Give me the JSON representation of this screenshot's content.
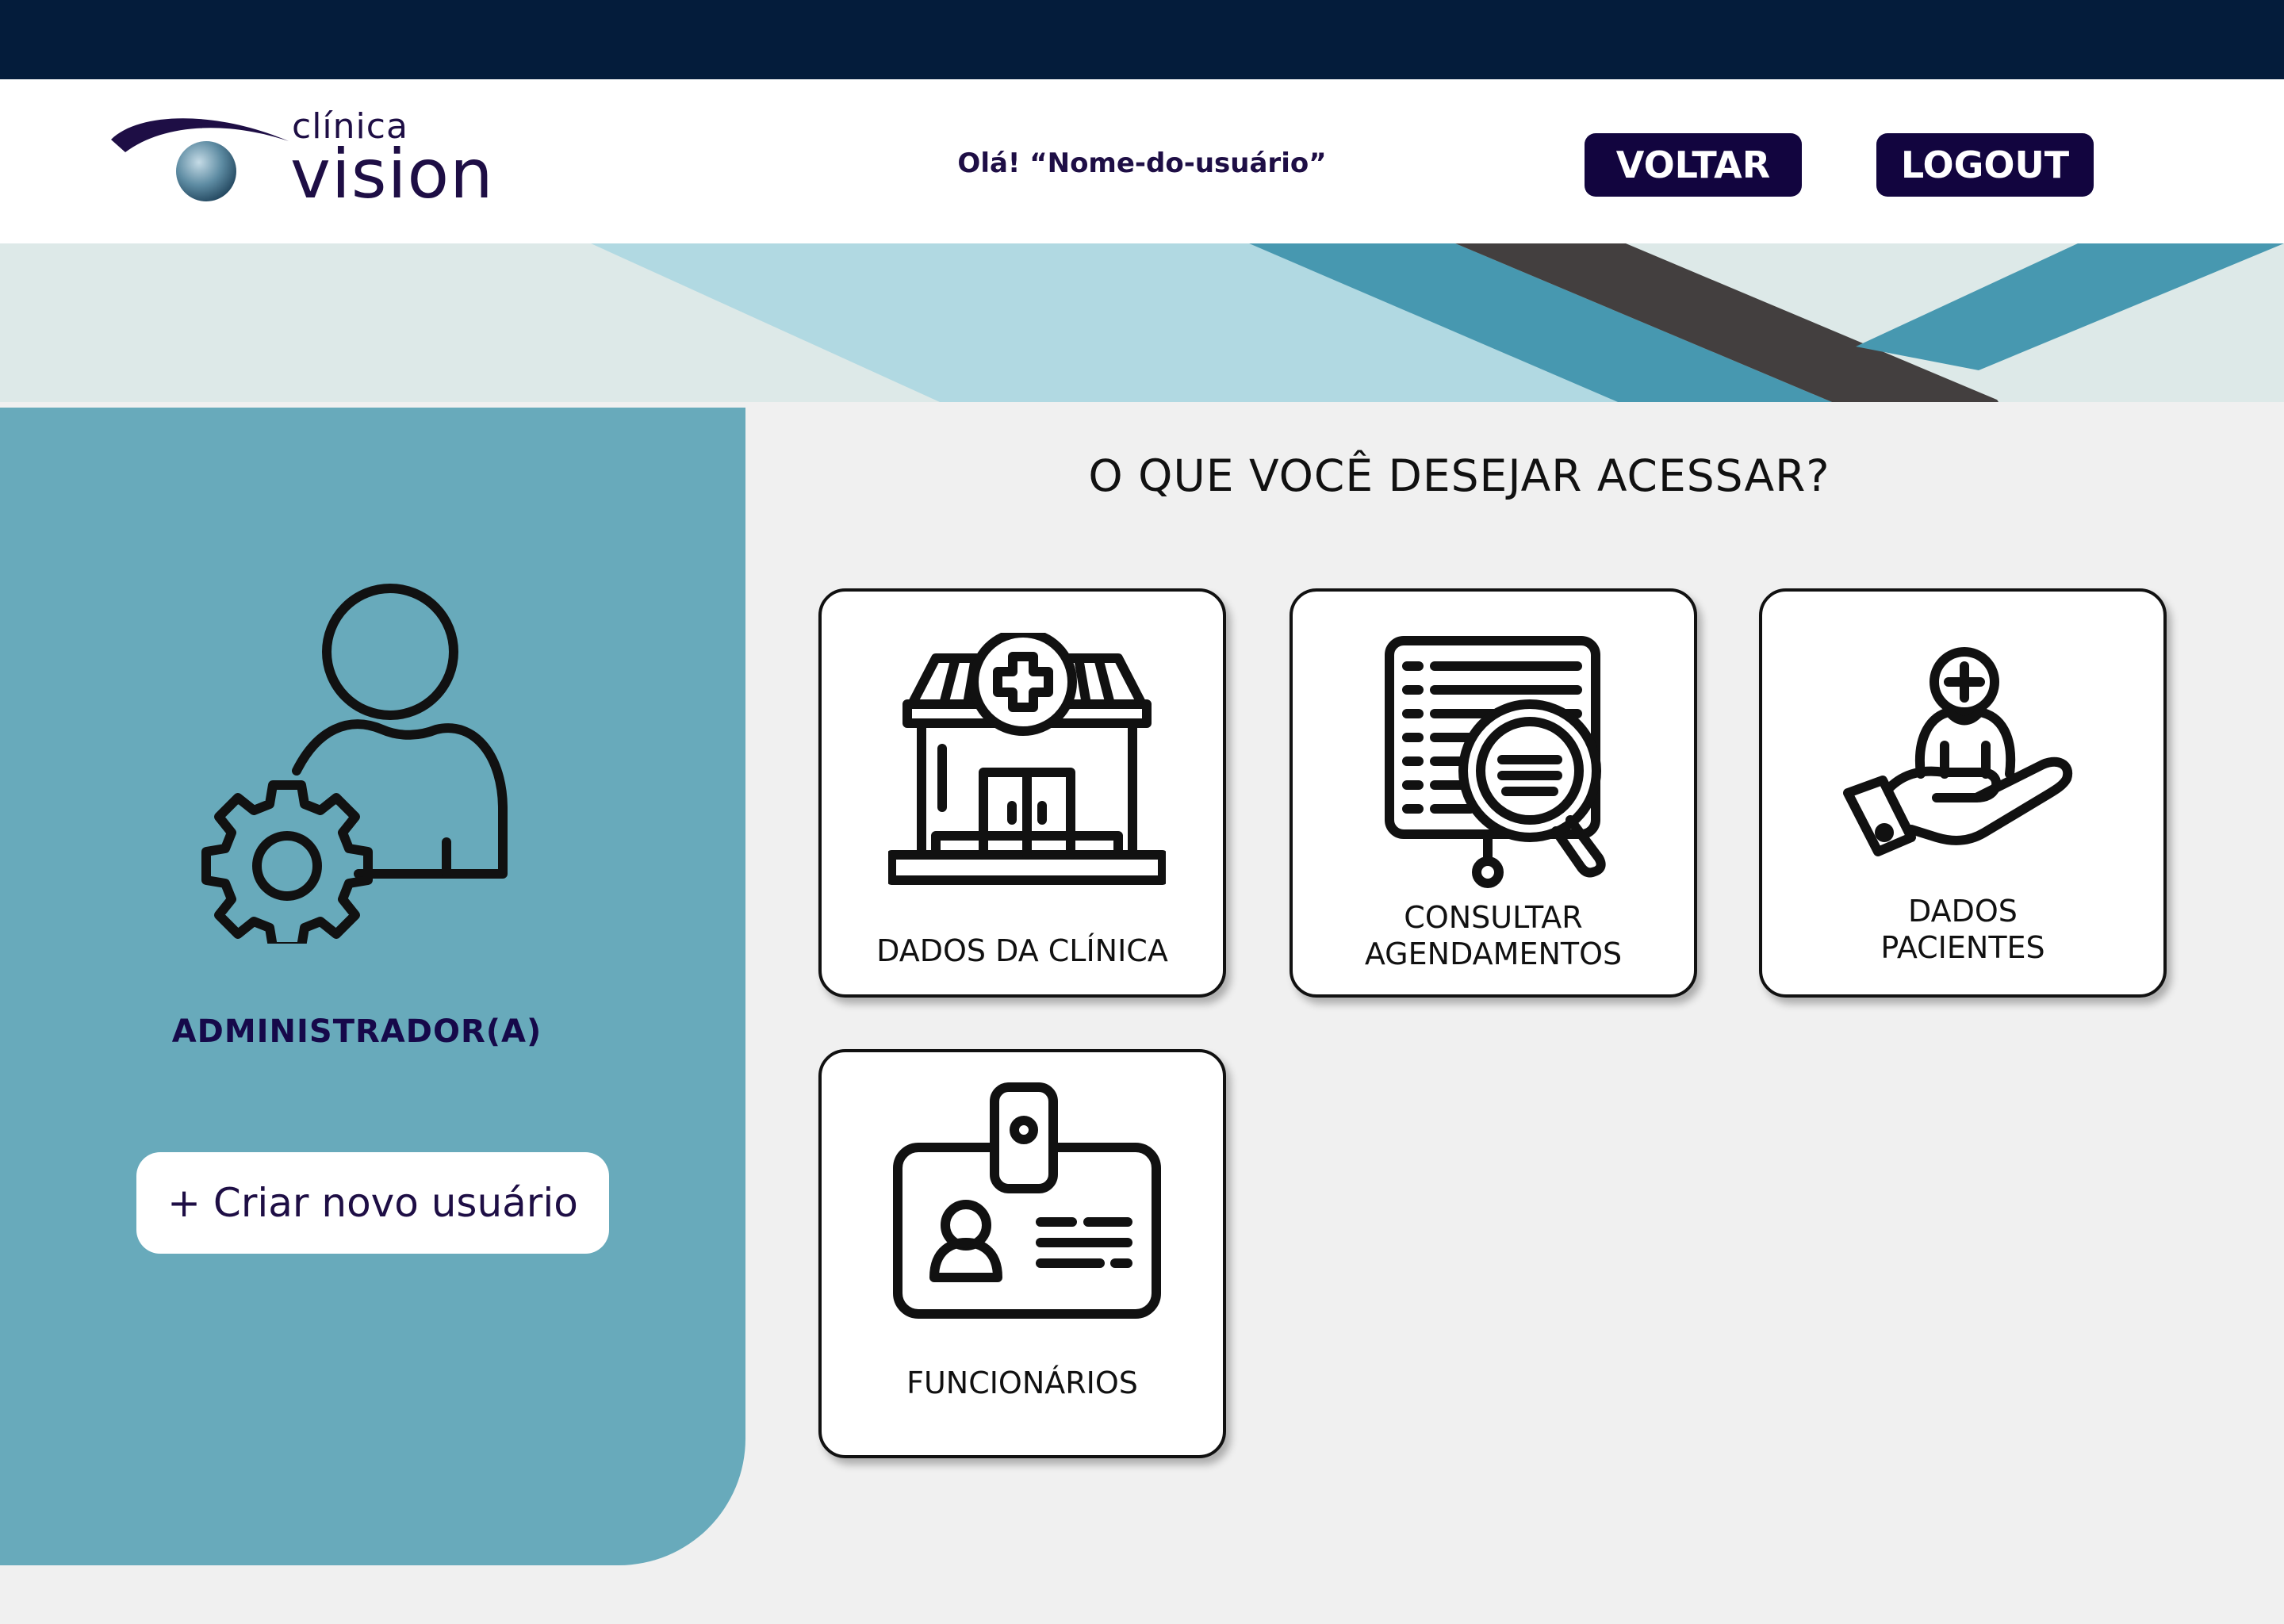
{
  "header": {
    "logo_small": "clínica",
    "logo_big": "vision",
    "greeting": "Olá! “Nome-do-usuário”",
    "back_label": "VOLTAR",
    "logout_label": "LOGOUT"
  },
  "sidebar": {
    "role_label": "ADMINISTRADOR(A)",
    "create_user_label": "+ Criar novo usuário"
  },
  "main": {
    "question": "O QUE VOCÊ DESEJAR ACESSAR?",
    "cards": [
      {
        "label_lines": [
          "DADOS DA CLÍNICA"
        ],
        "icon": "clinic-building-icon"
      },
      {
        "label_lines": [
          "CONSULTAR",
          "AGENDAMENTOS"
        ],
        "icon": "schedule-search-icon"
      },
      {
        "label_lines": [
          "DADOS",
          "PACIENTES"
        ],
        "icon": "patient-care-icon"
      },
      {
        "label_lines": [
          "FUNCIONÁRIOS"
        ],
        "icon": "employee-badge-icon"
      }
    ]
  },
  "colors": {
    "topbar": "#041c3b",
    "button": "#12053f",
    "sidebar": "#68aabb",
    "text_dark": "#1e0e45"
  }
}
